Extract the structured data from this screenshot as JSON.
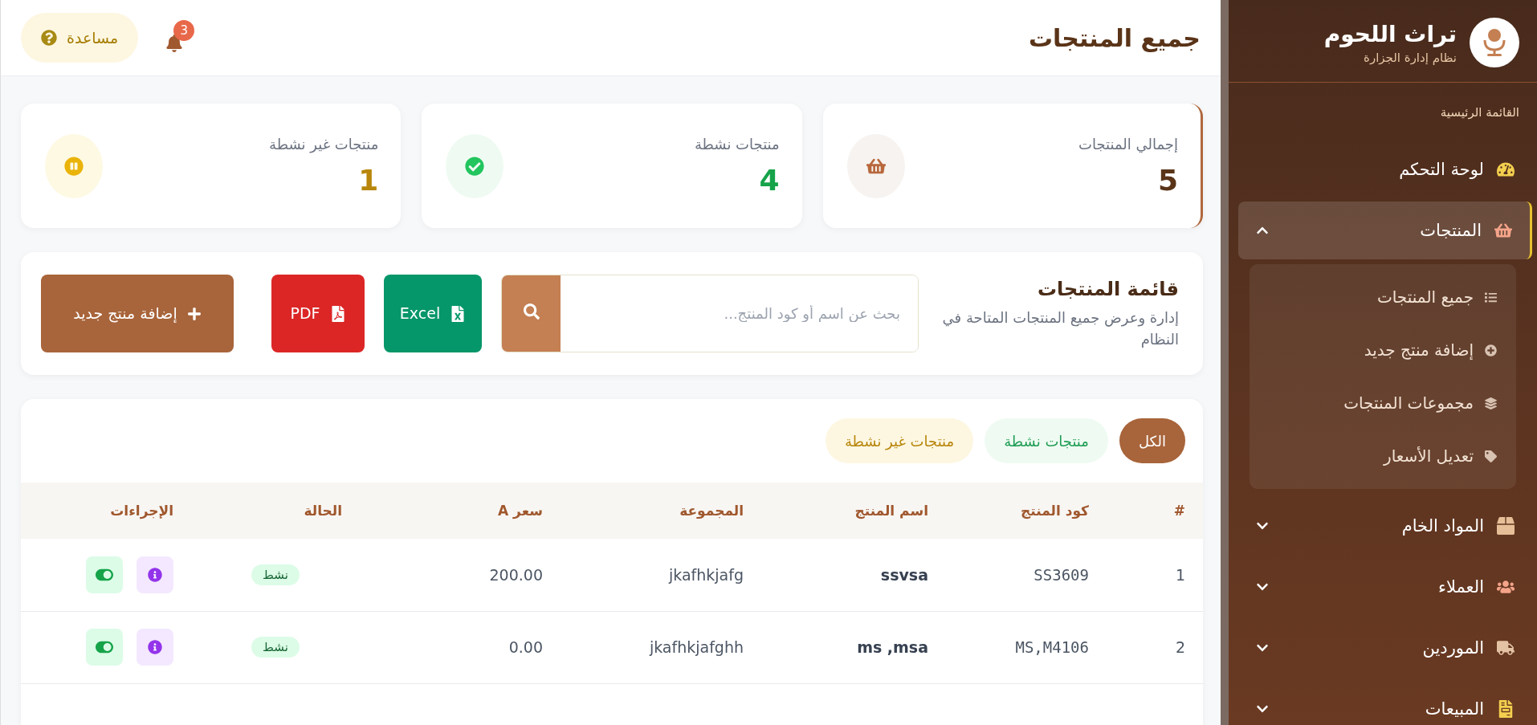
{
  "sidebar": {
    "brand": {
      "title": "تراث اللحوم",
      "subtitle": "نظام إدارة الجزارة"
    },
    "section": "القائمة الرئيسية",
    "items": [
      {
        "label": "لوحة التحكم",
        "kind": "link",
        "selected": false
      },
      {
        "label": "المنتجات",
        "kind": "group",
        "selected": true,
        "expanded": true,
        "children": [
          {
            "label": "جميع المنتجات"
          },
          {
            "label": "إضافة منتج جديد"
          },
          {
            "label": "مجموعات المنتجات"
          },
          {
            "label": "تعديل الأسعار"
          }
        ]
      },
      {
        "label": "المواد الخام",
        "kind": "group",
        "selected": false,
        "expanded": false
      },
      {
        "label": "العملاء",
        "kind": "group",
        "selected": false,
        "expanded": false
      },
      {
        "label": "الموردين",
        "kind": "group",
        "selected": false,
        "expanded": false
      },
      {
        "label": "المبيعات",
        "kind": "group",
        "selected": false,
        "expanded": false
      }
    ]
  },
  "header": {
    "title": "جميع المنتجات",
    "notifications": "3",
    "help": "مساعدة"
  },
  "stats": [
    {
      "label": "إجمالي المنتجات",
      "value": "5",
      "kind": "total"
    },
    {
      "label": "منتجات نشطة",
      "value": "4",
      "kind": "active"
    },
    {
      "label": "منتجات غير نشطة",
      "value": "1",
      "kind": "inactive"
    }
  ],
  "toolbar": {
    "title": "قائمة المنتجات",
    "subtitle": "إدارة وعرض جميع المنتجات المتاحة في النظام",
    "search": {
      "placeholder": "بحث عن اسم أو كود المنتج..."
    },
    "buttons": [
      {
        "label": "Excel",
        "kind": "excel"
      },
      {
        "label": "PDF",
        "kind": "pdf"
      },
      {
        "label": "إضافة منتج جديد",
        "kind": "add"
      }
    ]
  },
  "filters": [
    {
      "label": "الكل",
      "kind": "all",
      "selected": true
    },
    {
      "label": "منتجات نشطة",
      "kind": "active",
      "selected": false
    },
    {
      "label": "منتجات غير نشطة",
      "kind": "inactive",
      "selected": false
    }
  ],
  "table": {
    "columns": [
      "#",
      "كود المنتج",
      "اسم المنتج",
      "المجموعة",
      "سعر A",
      "الحالة",
      "الإجراءات"
    ],
    "rows": [
      {
        "index": "1",
        "code": "SS3609",
        "name": "ssvsa",
        "group": "jkafhkjafg",
        "price": "200.00",
        "status": "نشط",
        "active": true
      },
      {
        "index": "2",
        "code": "MS,M4106",
        "name": "ms ,msa",
        "group": "jkafhkjafghh",
        "price": "0.00",
        "status": "نشط",
        "active": true
      }
    ]
  }
}
